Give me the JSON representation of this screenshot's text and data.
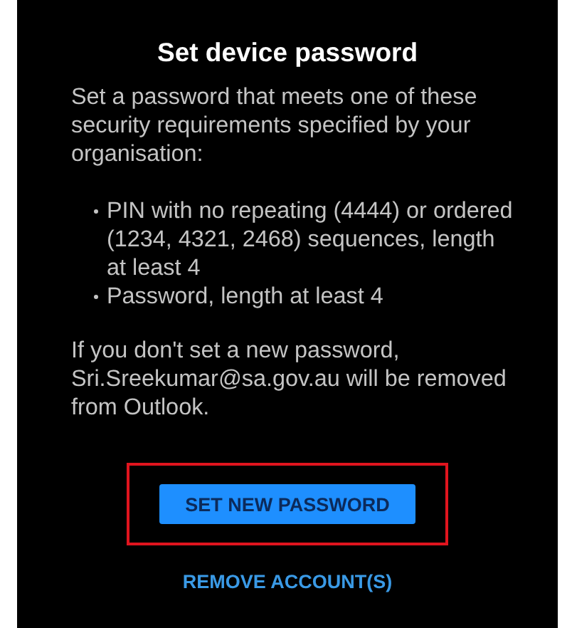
{
  "dialog": {
    "title": "Set device password",
    "intro": "Set a password that meets one of these security requirements specified by your organisation:",
    "requirements": [
      "PIN with no repeating (4444) or ordered (1234, 4321, 2468) sequences, length at least 4",
      "Password, length at least 4"
    ],
    "warning": "If you don't set a new password, Sri.Sreekumar@sa.gov.au will be removed from Outlook.",
    "primary_button": {
      "label": "SET NEW PASSWORD",
      "highlighted": true
    },
    "secondary_button": {
      "label": "REMOVE ACCOUNT(S)"
    }
  }
}
